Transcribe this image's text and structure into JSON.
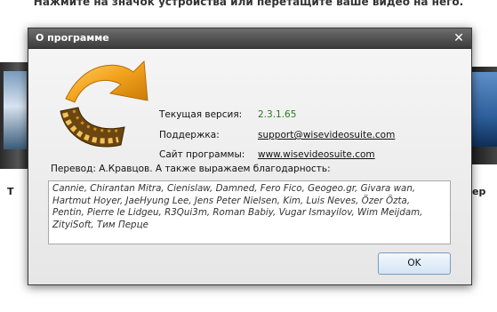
{
  "background": {
    "top_text": "Нажмите на значок устройства или перетащите ваше видео на него.",
    "left_label": "T",
    "right_label": "ер"
  },
  "dialog": {
    "title": "О программе",
    "close_glyph": "✕",
    "version_label": "Текущая версия:",
    "version_value": "2.3.1.65",
    "support_label": "Поддержка:",
    "support_value": "support@wisevideosuite.com",
    "site_label": "Сайт программы:",
    "site_value": "www.wisevideosuite.com",
    "translator_text": "Перевод: А.Кравцов. А также выражаем благодарность:",
    "credits": "Cannie, Chirantan Mitra, Cienislaw, Damned, Fero Fico, Geogeo.gr, Givara wan, Hartmut Hoyer, JaeHyung Lee, Jens Peter Nielsen, Kim, Luis Neves, Özer Özta, Pentin, Pierre le Lidgeu, R3Qui3m, Roman Babiy, Vugar Ismayilov, Wim Meijdam, ZityiSoft, Тим Перце",
    "ok_label": "OK"
  },
  "icons": {
    "logo": "film-reel-arrow-icon",
    "close": "close-icon"
  },
  "colors": {
    "titlebar": "#4a4a4a",
    "version_green": "#2a7a1e",
    "logo_orange": "#f2a21c",
    "film_brown": "#5a3a0a"
  }
}
